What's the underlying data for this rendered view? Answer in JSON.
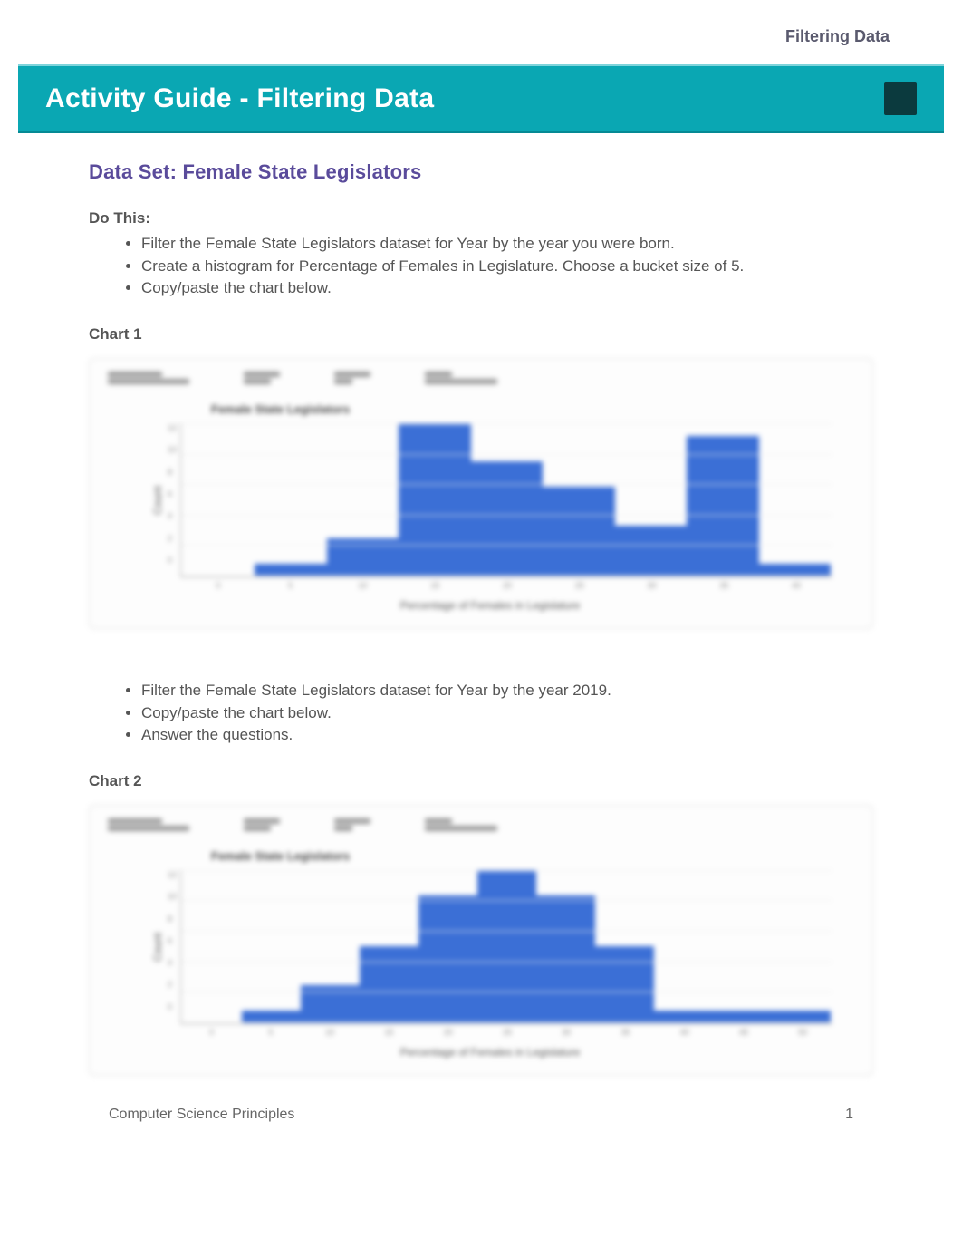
{
  "header": {
    "top_right_label": "Filtering Data",
    "title": "Activity Guide - Filtering Data"
  },
  "section": {
    "heading": "Data Set: Female State Legislators",
    "do_this_label": "Do This:",
    "instructions_a": [
      "Filter the Female State Legislators dataset for Year by the year you were born.",
      "Create a histogram for Percentage of Females in Legislature. Choose a bucket size of 5.",
      "Copy/paste the chart below."
    ],
    "chart1_label": "Chart 1",
    "instructions_b": [
      "Filter the Female State Legislators dataset for Year by the year 2019.",
      "Copy/paste the chart below.",
      "Answer the questions."
    ],
    "chart2_label": "Chart 2"
  },
  "chart_data": [
    {
      "type": "bar",
      "title": "Female State Legislators",
      "xlabel": "Percentage of Females in Legislature",
      "ylabel": "Count",
      "categories": [
        "0",
        "5",
        "10",
        "15",
        "20",
        "25",
        "30",
        "35",
        "40"
      ],
      "values": [
        0,
        1,
        3,
        12,
        9,
        7,
        4,
        11,
        1
      ],
      "ylim": [
        0,
        12
      ]
    },
    {
      "type": "bar",
      "title": "Female State Legislators",
      "xlabel": "Percentage of Females in Legislature",
      "ylabel": "Count",
      "categories": [
        "0",
        "5",
        "10",
        "15",
        "20",
        "25",
        "30",
        "35",
        "40",
        "45",
        "50"
      ],
      "values": [
        0,
        1,
        3,
        6,
        10,
        12,
        10,
        6,
        1,
        1,
        1
      ],
      "ylim": [
        0,
        12
      ]
    }
  ],
  "footer": {
    "left": "Computer Science Principles",
    "page": "1"
  }
}
